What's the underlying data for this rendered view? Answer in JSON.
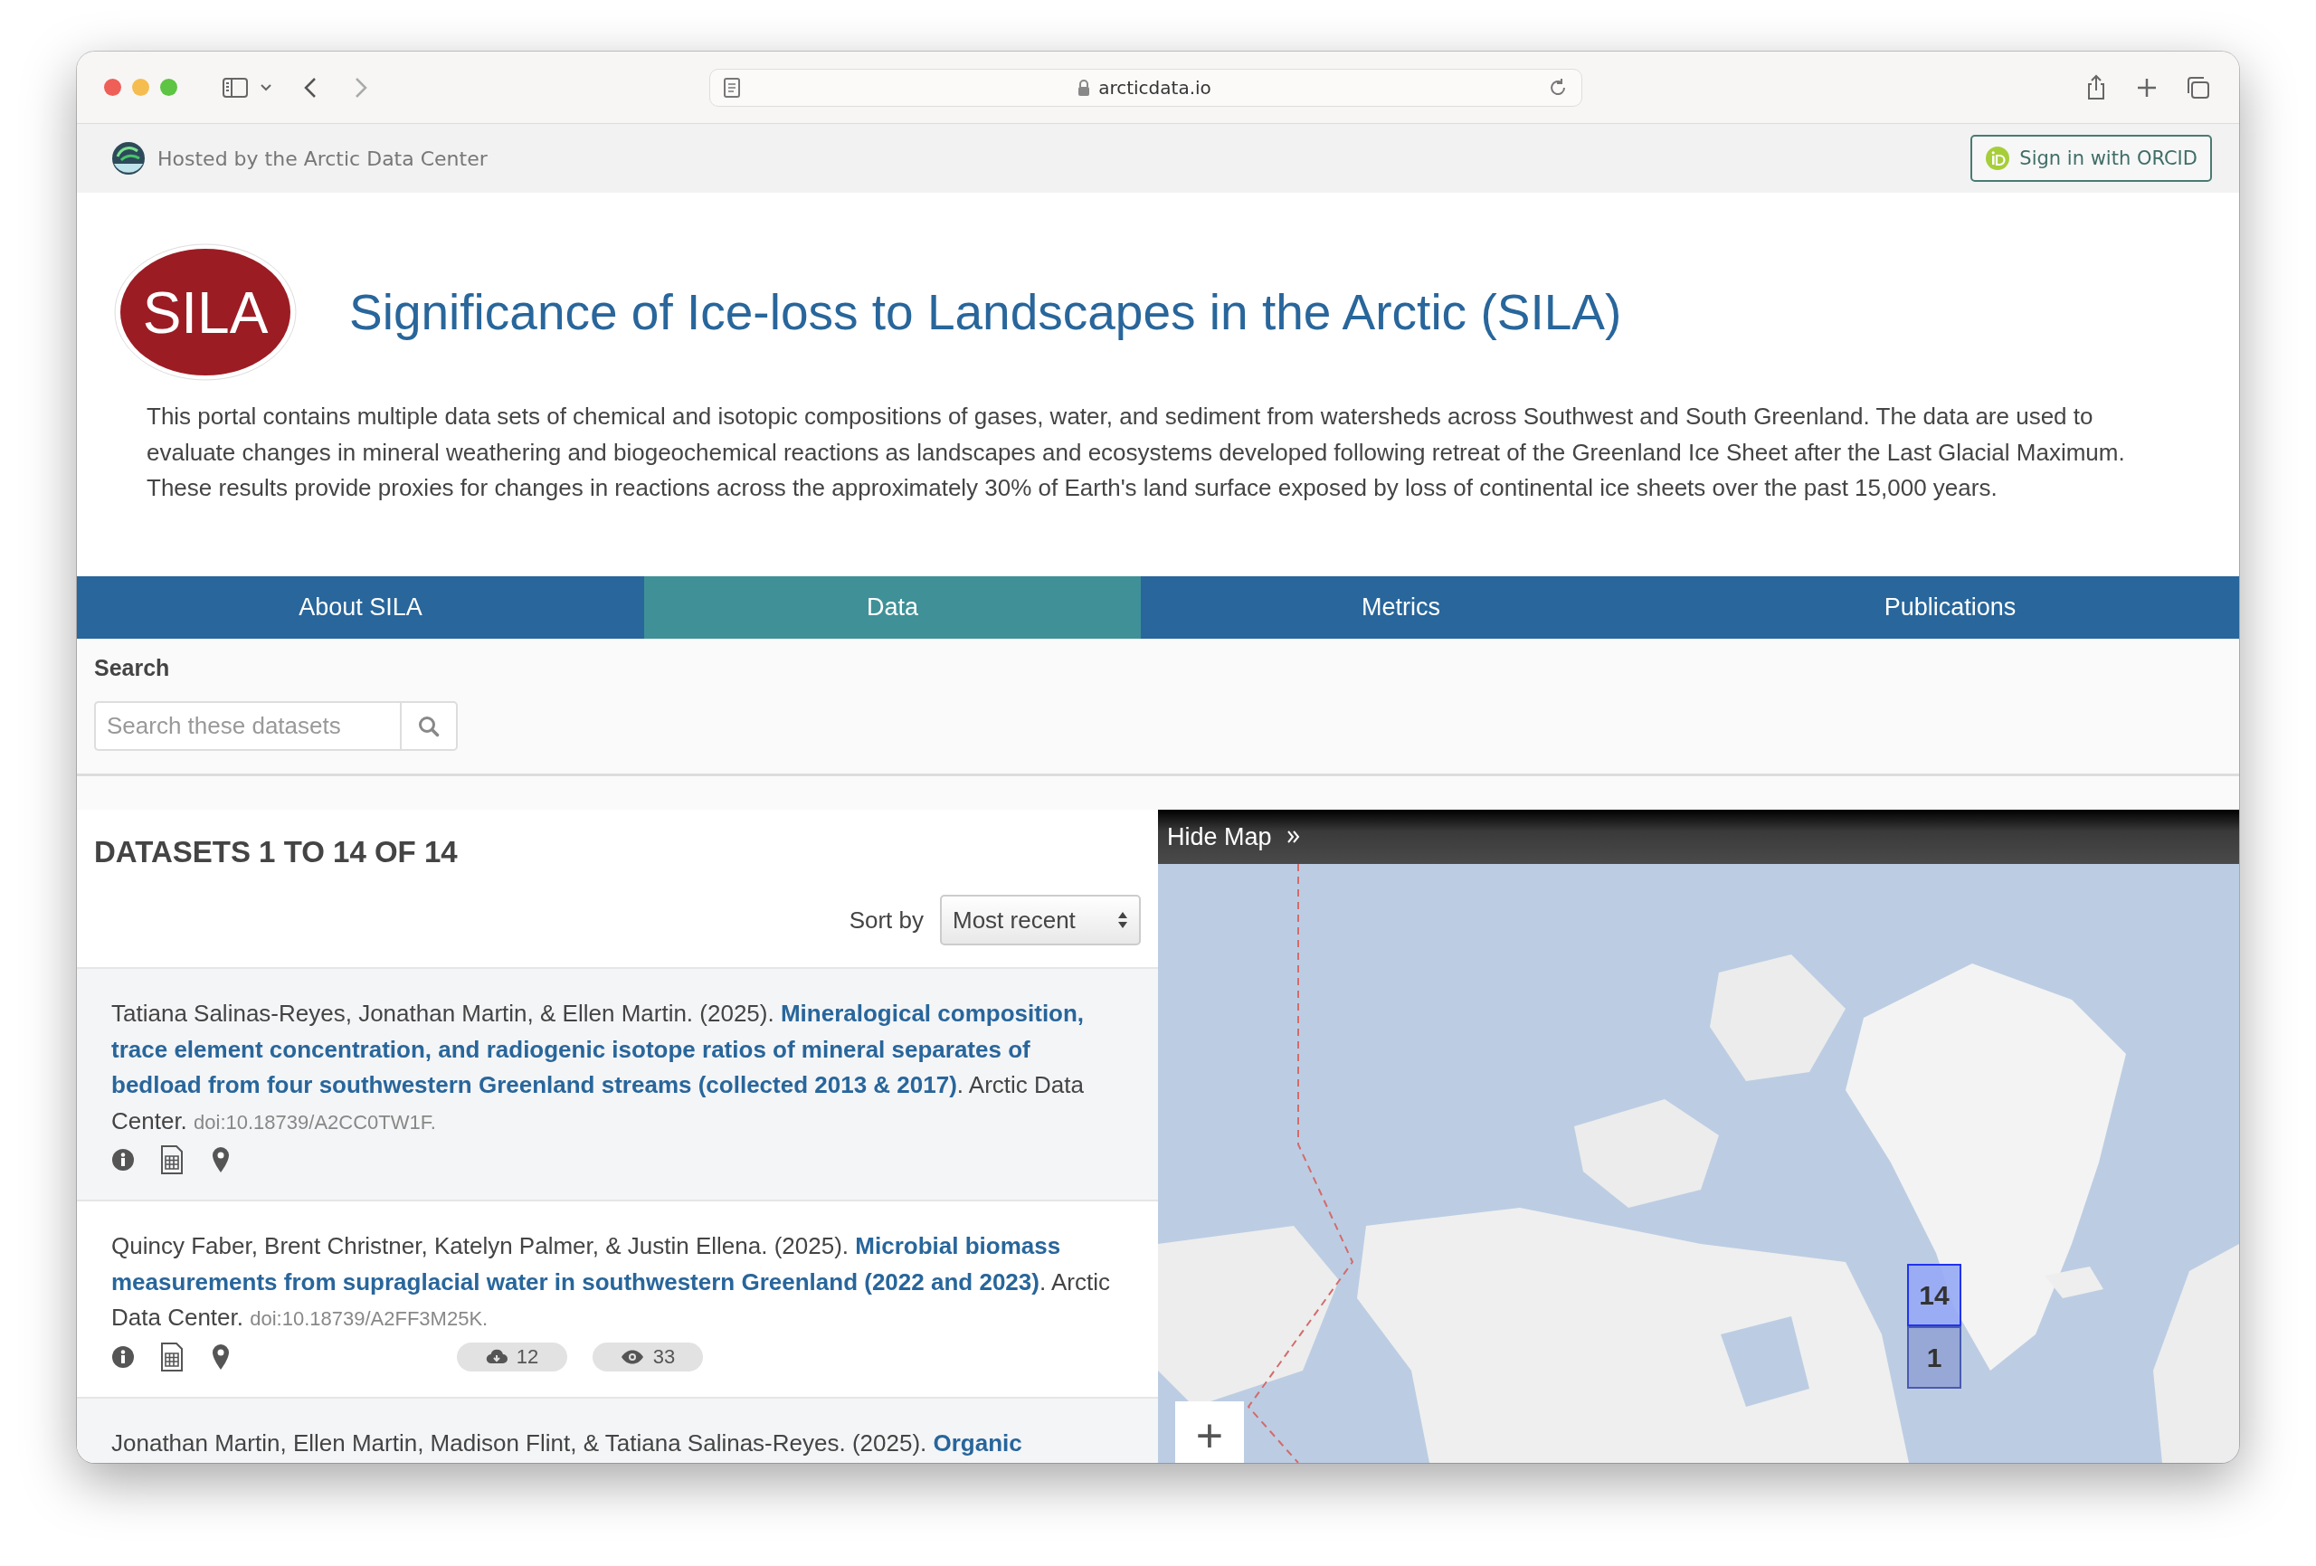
{
  "browser": {
    "url": "arcticdata.io"
  },
  "host_bar": {
    "text": "Hosted by the Arctic Data Center",
    "sign_in": "Sign in with ORCID"
  },
  "header": {
    "logo_text": "SILA",
    "title": "Significance of Ice-loss to Landscapes in the Arctic (SILA)",
    "description": "This portal contains multiple data sets of chemical and isotopic compositions of gases, water, and sediment from watersheds across Southwest and South Greenland. The data are used to evaluate changes in mineral weathering and biogeochemical reactions as landscapes and ecosystems developed following retreat of the Greenland Ice Sheet after the Last Glacial Maximum. These results provide proxies for changes in reactions across the approximately 30% of Earth's land surface exposed by loss of continental ice sheets over the past 15,000 years."
  },
  "tabs": [
    {
      "label": "About SILA",
      "selected": false
    },
    {
      "label": "Data",
      "selected": true
    },
    {
      "label": "Metrics",
      "selected": false
    },
    {
      "label": "Publications",
      "selected": false
    }
  ],
  "search": {
    "label": "Search",
    "placeholder": "Search these datasets"
  },
  "results": {
    "heading": "DATASETS 1 TO 14 OF 14",
    "sort_label": "Sort by",
    "sort_value": "Most recent"
  },
  "datasets": [
    {
      "authors": "Tatiana Salinas-Reyes, Jonathan Martin, & Ellen Martin. (2025).",
      "title": "Mineralogical composition, trace element concentration, and radiogenic isotope ratios of mineral separates of bedload from four southwestern Greenland streams (collected 2013 & 2017)",
      "publisher": ". Arctic Data Center.",
      "doi": "doi:10.18739/A2CC0TW1F."
    },
    {
      "authors": "Quincy Faber, Brent Christner, Katelyn Palmer, & Justin Ellena. (2025).",
      "title": "Microbial biomass measurements from supraglacial water in southwestern Greenland (2022 and 2023)",
      "publisher": ". Arctic Data Center.",
      "doi": "doi:10.18739/A2FF3M25K.",
      "downloads": "12",
      "views": "33"
    },
    {
      "authors": "Jonathan Martin, Ellen Martin, Madison Flint, & Tatiana Salinas-Reyes. (2025).",
      "title": "Organic"
    }
  ],
  "map": {
    "toggle": "Hide Map",
    "clusters": [
      {
        "count": "14",
        "selected": true
      },
      {
        "count": "1",
        "selected": false
      }
    ],
    "zoom_in": "+"
  }
}
